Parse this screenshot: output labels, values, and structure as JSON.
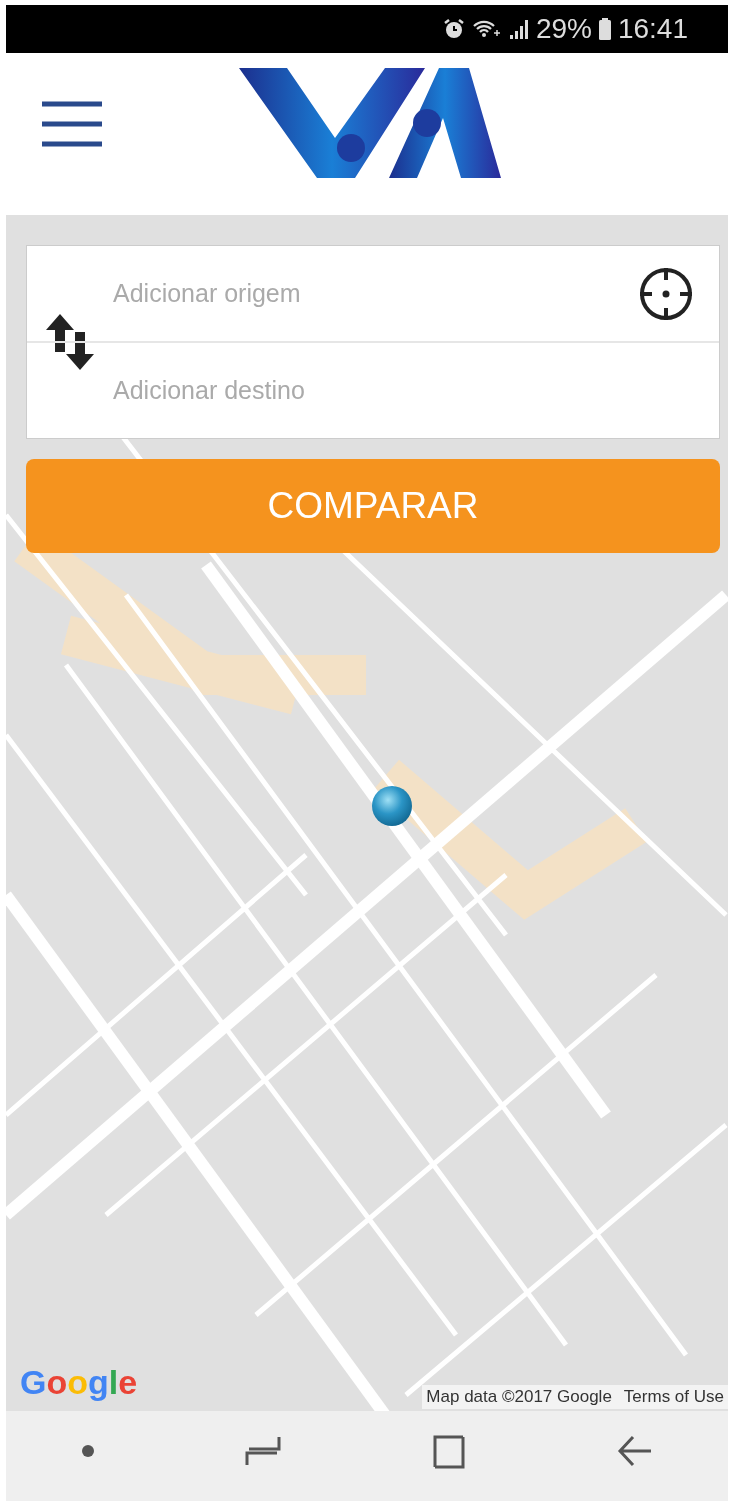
{
  "status_bar": {
    "battery": "29%",
    "time": "16:41"
  },
  "search": {
    "origin": {
      "placeholder": "Adicionar origem"
    },
    "destination": {
      "placeholder": "Adicionar destino"
    }
  },
  "compare_button": "COMPARAR",
  "map": {
    "logo": "Google",
    "attribution": "Map data ©2017 Google",
    "terms": "Terms of Use"
  }
}
